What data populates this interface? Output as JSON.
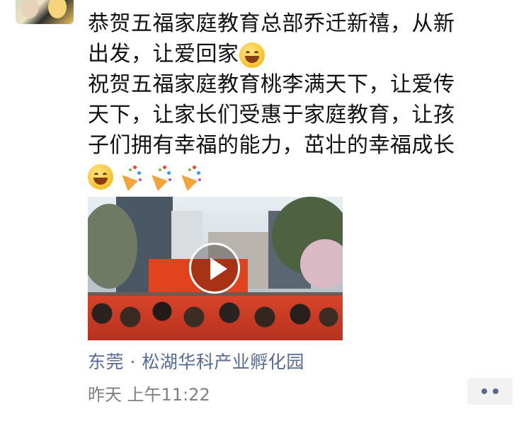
{
  "post": {
    "text_line1": "恭贺五福家庭教育总部乔迁新禧，从新",
    "text_line2": "出发，让爱回家",
    "text_line3": "祝贺五福家庭教育桃李满天下，让爱传",
    "text_line4": "天下，让家长们受惠于家庭教育，让孩",
    "text_line5": "子们拥有幸福的能力，茁壮的幸福成长",
    "emojis": [
      "grinning-face-icon",
      "party-popper-icon",
      "party-popper-icon",
      "party-popper-icon"
    ]
  },
  "video": {
    "thumbnail": "video-thumbnail",
    "play_icon": "play-icon"
  },
  "location": "东莞 · 松湖华科产业孵化园",
  "timestamp": "昨天 上午11:22",
  "more_icon": "more-dots-icon",
  "colors": {
    "link": "#576b95",
    "timestamp": "#7f7f7f",
    "text": "#111111"
  }
}
